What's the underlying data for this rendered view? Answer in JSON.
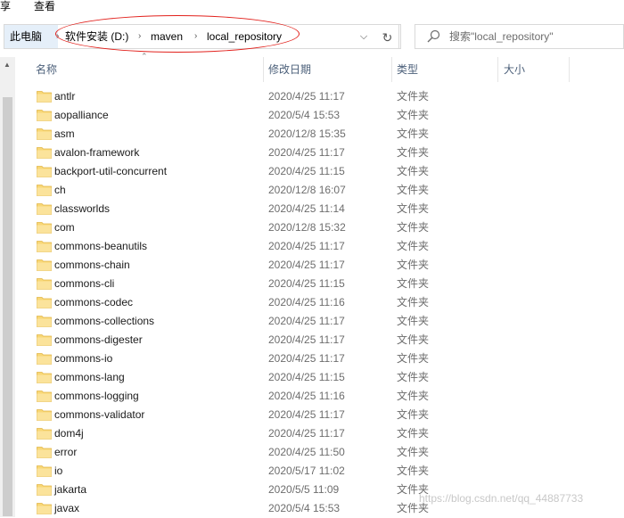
{
  "menu": {
    "share": "享",
    "view": "查看"
  },
  "breadcrumb": {
    "pc": "此电脑",
    "segments": [
      "软件安装 (D:)",
      "maven",
      "local_repository"
    ]
  },
  "search": {
    "placeholder": "搜索\"local_repository\""
  },
  "columns": {
    "name": "名称",
    "date": "修改日期",
    "type": "类型",
    "size": "大小"
  },
  "files": [
    {
      "name": "antlr",
      "date": "2020/4/25 11:17",
      "type": "文件夹"
    },
    {
      "name": "aopalliance",
      "date": "2020/5/4 15:53",
      "type": "文件夹"
    },
    {
      "name": "asm",
      "date": "2020/12/8 15:35",
      "type": "文件夹"
    },
    {
      "name": "avalon-framework",
      "date": "2020/4/25 11:17",
      "type": "文件夹"
    },
    {
      "name": "backport-util-concurrent",
      "date": "2020/4/25 11:15",
      "type": "文件夹"
    },
    {
      "name": "ch",
      "date": "2020/12/8 16:07",
      "type": "文件夹"
    },
    {
      "name": "classworlds",
      "date": "2020/4/25 11:14",
      "type": "文件夹"
    },
    {
      "name": "com",
      "date": "2020/12/8 15:32",
      "type": "文件夹"
    },
    {
      "name": "commons-beanutils",
      "date": "2020/4/25 11:17",
      "type": "文件夹"
    },
    {
      "name": "commons-chain",
      "date": "2020/4/25 11:17",
      "type": "文件夹"
    },
    {
      "name": "commons-cli",
      "date": "2020/4/25 11:15",
      "type": "文件夹"
    },
    {
      "name": "commons-codec",
      "date": "2020/4/25 11:16",
      "type": "文件夹"
    },
    {
      "name": "commons-collections",
      "date": "2020/4/25 11:17",
      "type": "文件夹"
    },
    {
      "name": "commons-digester",
      "date": "2020/4/25 11:17",
      "type": "文件夹"
    },
    {
      "name": "commons-io",
      "date": "2020/4/25 11:17",
      "type": "文件夹"
    },
    {
      "name": "commons-lang",
      "date": "2020/4/25 11:15",
      "type": "文件夹"
    },
    {
      "name": "commons-logging",
      "date": "2020/4/25 11:16",
      "type": "文件夹"
    },
    {
      "name": "commons-validator",
      "date": "2020/4/25 11:17",
      "type": "文件夹"
    },
    {
      "name": "dom4j",
      "date": "2020/4/25 11:17",
      "type": "文件夹"
    },
    {
      "name": "error",
      "date": "2020/4/25 11:50",
      "type": "文件夹"
    },
    {
      "name": "io",
      "date": "2020/5/17 11:02",
      "type": "文件夹"
    },
    {
      "name": "jakarta",
      "date": "2020/5/5 11:09",
      "type": "文件夹"
    },
    {
      "name": "javax",
      "date": "2020/5/4 15:53",
      "type": "文件夹"
    }
  ],
  "watermark": "https://blog.csdn.net/qq_44887733",
  "colors": {
    "folder": "#f8d775",
    "annotation": "#e2211c",
    "header_text": "#4c607a"
  },
  "icons": [
    "chevron-down-icon",
    "refresh-icon",
    "search-icon",
    "folder-icon",
    "breadcrumb-separator-icon"
  ]
}
